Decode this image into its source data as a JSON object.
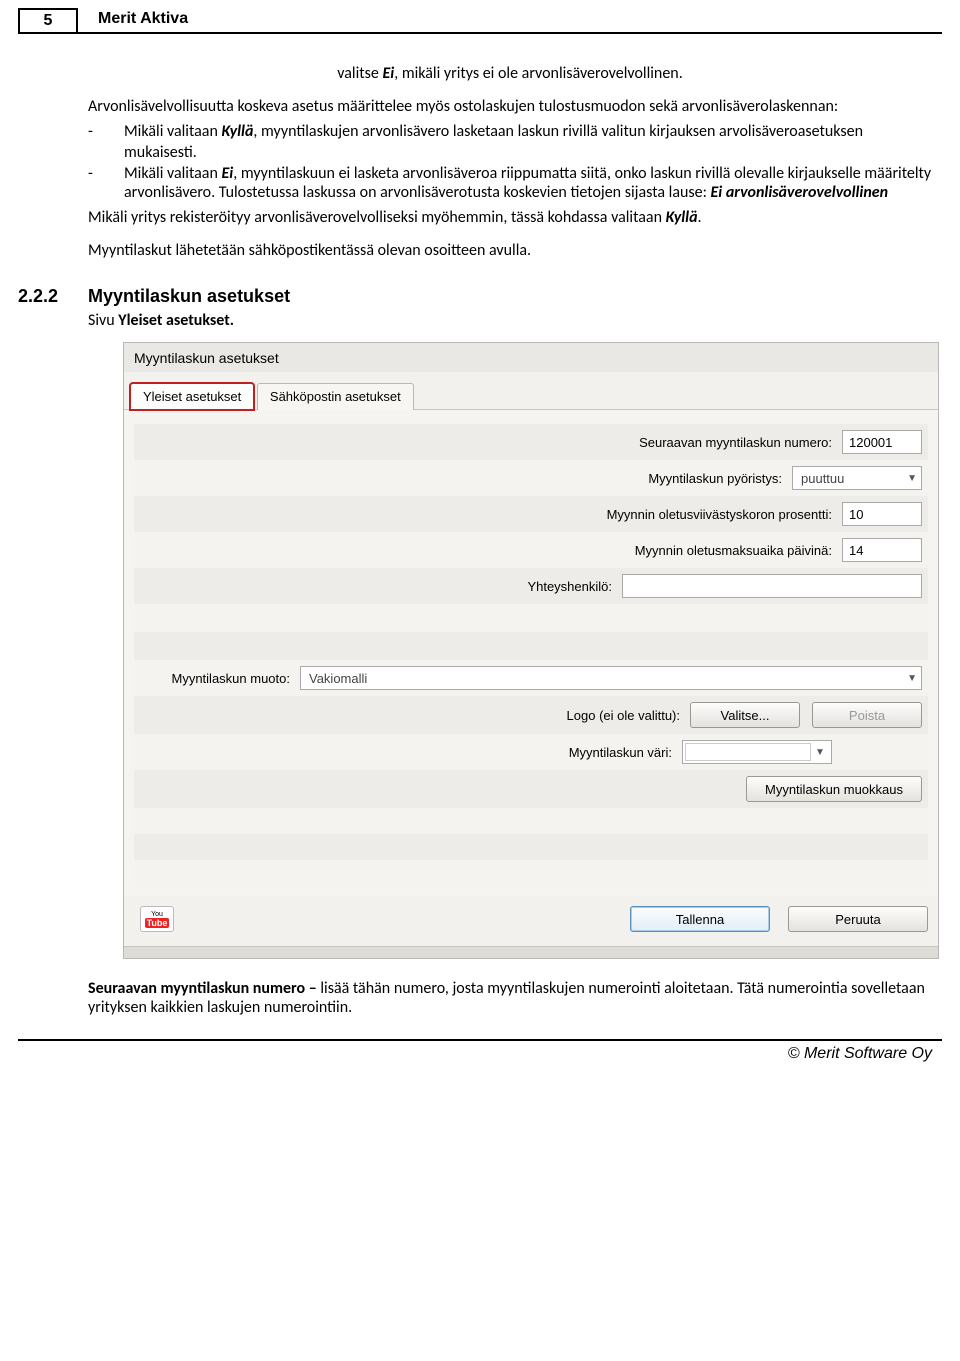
{
  "header": {
    "page_number": "5",
    "title": "Merit Aktiva"
  },
  "intro": {
    "center_pre": "valitse ",
    "center_ei": "Ei",
    "center_post": ", mikäli yritys ei ole arvonlisäverovelvollinen.",
    "p1_a": "Arvonlisävelvollisuutta koskeva asetus määrittelee myös ostolaskujen tulostusmuodon sekä arvonlisäverolaskennan:",
    "b1_pre": "Mikäli valitaan ",
    "b1_k": "Kyllä",
    "b1_post": ", myyntilaskujen arvonlisävero lasketaan laskun rivillä valitun kirjauksen arvolisäveroasetuksen",
    "b1_line2": "mukaisesti.",
    "b2_pre": "Mikäli valitaan ",
    "b2_ei": "Ei",
    "b2_post": ", myyntilaskuun ei lasketa arvonlisäveroa riippumatta siitä, onko laskun rivillä olevalle kirjaukselle määritelty arvonlisävero. Tulostetussa laskussa on arvonlisäverotusta koskevien tietojen sijasta lause: ",
    "b2_bold": "Ei arvonlisäverovelvollinen",
    "p2_a": "Mikäli yritys rekisteröityy arvonlisäverovelvolliseksi myöhemmin, tässä kohdassa valitaan ",
    "p2_k": "Kyllä",
    "p2_b": ".",
    "p3": "Myyntilaskut lähetetään sähköpostikentässä olevan osoitteen avulla."
  },
  "section": {
    "num": "2.2.2",
    "title": "Myyntilaskun asetukset",
    "sivu_pre": "Sivu ",
    "sivu_bold": "Yleiset asetukset."
  },
  "shot": {
    "window_title": "Myyntilaskun asetukset",
    "tabs": {
      "t1": "Yleiset asetukset",
      "t2": "Sähköpostin asetukset"
    },
    "labels": {
      "next_invoice": "Seuraavan myyntilaskun numero:",
      "rounding": "Myyntilaskun pyöristys:",
      "interest": "Myynnin  oletusviivästyskoron prosentti:",
      "payment_days": "Myynnin oletusmaksuaika päivinä:",
      "contact": "Yhteyshenkilö:",
      "format": "Myyntilaskun muoto:",
      "logo": "Logo (ei ole valittu):",
      "color": "Myyntilaskun väri:"
    },
    "values": {
      "next_invoice": "120001",
      "rounding": "puuttuu",
      "interest": "10",
      "payment_days": "14",
      "contact": "",
      "format": "Vakiomalli"
    },
    "buttons": {
      "choose": "Valitse...",
      "remove": "Poista",
      "edit_invoice": "Myyntilaskun muokkaus",
      "save": "Tallenna",
      "cancel": "Peruuta"
    },
    "youtube": {
      "l1": "You",
      "l2": "Tube"
    }
  },
  "after": {
    "bold": "Seuraavan myyntilaskun numero – ",
    "text": "lisää tähän numero, josta myyntilaskujen numerointi aloitetaan. Tätä numerointia sovelletaan yrityksen kaikkien laskujen numerointiin."
  },
  "footer": "© Merit Software Oy"
}
